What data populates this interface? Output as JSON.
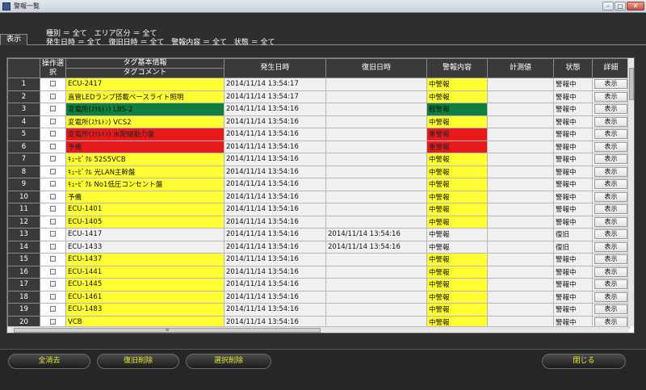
{
  "window": {
    "title": "警報一覧"
  },
  "tab": {
    "label": "表示"
  },
  "filters": {
    "line1": [
      "種別 ＝ 全て",
      "エリア区分 ＝ 全て"
    ],
    "line2": [
      "発生日時 ＝ 全て",
      "復旧日時 ＝ 全て",
      "警報内容 ＝ 全て",
      "状態 ＝ 全て"
    ]
  },
  "columns": {
    "select": "操作選択",
    "tag_info": "タグ基本情報",
    "tag_comment": "タグコメント",
    "occurred": "発生日時",
    "restored": "復旧日時",
    "alarm": "警報内容",
    "measured": "計測値",
    "state": "状態",
    "detail": "詳細"
  },
  "colors": {
    "yellow": "#ffff33",
    "green": "#0f7f3d",
    "red": "#e8191b",
    "gray": "#f0f0f0"
  },
  "rows": [
    {
      "num": "1",
      "comment": "ECU-2417",
      "occurred": "2014/11/14  13:54:17",
      "restored": "",
      "alarm": "中警報",
      "state": "警報中",
      "detail": "表示",
      "color": "y"
    },
    {
      "num": "2",
      "comment": "直管LEDランプ搭載ベースライト照明",
      "occurred": "2014/11/14  13:54:17",
      "restored": "",
      "alarm": "中警報",
      "state": "警報中",
      "detail": "表示",
      "color": "y"
    },
    {
      "num": "3",
      "comment": "変電所(ｽｹﾙﾄﾝ) LBS-2",
      "occurred": "2014/11/14  13:54:16",
      "restored": "",
      "alarm": "軽警報",
      "state": "警報中",
      "detail": "表示",
      "color": "g"
    },
    {
      "num": "4",
      "comment": "変電所(ｽｹﾙﾄﾝ) VCS2",
      "occurred": "2014/11/14  13:54:16",
      "restored": "",
      "alarm": "中警報",
      "state": "警報中",
      "detail": "表示",
      "color": "y"
    },
    {
      "num": "5",
      "comment": "変電所(ｽｹﾙﾄﾝ) 水配継動力盤",
      "occurred": "2014/11/14  13:54:16",
      "restored": "",
      "alarm": "重警報",
      "state": "警報中",
      "detail": "表示",
      "color": "r"
    },
    {
      "num": "6",
      "comment": "予備",
      "occurred": "2014/11/14  13:54:16",
      "restored": "",
      "alarm": "重警報",
      "state": "警報中",
      "detail": "表示",
      "color": "r"
    },
    {
      "num": "7",
      "comment": "ｷｭｰﾋﾞｸﾙ  52S5VCB",
      "occurred": "2014/11/14  13:54:16",
      "restored": "",
      "alarm": "中警報",
      "state": "警報中",
      "detail": "表示",
      "color": "y"
    },
    {
      "num": "8",
      "comment": "ｷｭｰﾋﾞｸﾙ  光LAN主幹盤",
      "occurred": "2014/11/14  13:54:16",
      "restored": "",
      "alarm": "中警報",
      "state": "警報中",
      "detail": "表示",
      "color": "y"
    },
    {
      "num": "9",
      "comment": "ｷｭｰﾋﾞｸﾙ  No1低圧コンセント盤",
      "occurred": "2014/11/14  13:54:16",
      "restored": "",
      "alarm": "中警報",
      "state": "警報中",
      "detail": "表示",
      "color": "y"
    },
    {
      "num": "10",
      "comment": "予備",
      "occurred": "2014/11/14  13:54:16",
      "restored": "",
      "alarm": "中警報",
      "state": "警報中",
      "detail": "表示",
      "color": "y"
    },
    {
      "num": "11",
      "comment": "ECU-1401",
      "occurred": "2014/11/14  13:54:16",
      "restored": "",
      "alarm": "中警報",
      "state": "警報中",
      "detail": "表示",
      "color": "y"
    },
    {
      "num": "12",
      "comment": "ECU-1405",
      "occurred": "2014/11/14  13:54:16",
      "restored": "",
      "alarm": "中警報",
      "state": "警報中",
      "detail": "表示",
      "color": "y"
    },
    {
      "num": "13",
      "comment": "ECU-1417",
      "occurred": "2014/11/14  13:54:16",
      "restored": "2014/11/14  13:54:16",
      "alarm": "中警報",
      "state": "復旧",
      "detail": "表示",
      "color": "w"
    },
    {
      "num": "14",
      "comment": "ECU-1433",
      "occurred": "2014/11/14  13:54:16",
      "restored": "2014/11/14  13:54:16",
      "alarm": "中警報",
      "state": "復旧",
      "detail": "表示",
      "color": "w"
    },
    {
      "num": "15",
      "comment": "ECU-1437",
      "occurred": "2014/11/14  13:54:16",
      "restored": "",
      "alarm": "中警報",
      "state": "警報中",
      "detail": "表示",
      "color": "y"
    },
    {
      "num": "16",
      "comment": "ECU-1441",
      "occurred": "2014/11/14  13:54:16",
      "restored": "",
      "alarm": "中警報",
      "state": "警報中",
      "detail": "表示",
      "color": "y"
    },
    {
      "num": "17",
      "comment": "ECU-1445",
      "occurred": "2014/11/14  13:54:16",
      "restored": "",
      "alarm": "中警報",
      "state": "警報中",
      "detail": "表示",
      "color": "y"
    },
    {
      "num": "18",
      "comment": "ECU-1461",
      "occurred": "2014/11/14  13:54:16",
      "restored": "",
      "alarm": "中警報",
      "state": "警報中",
      "detail": "表示",
      "color": "y"
    },
    {
      "num": "19",
      "comment": "ECU-1483",
      "occurred": "2014/11/14  13:54:16",
      "restored": "",
      "alarm": "中警報",
      "state": "警報中",
      "detail": "表示",
      "color": "y"
    },
    {
      "num": "20",
      "comment": "VCB",
      "occurred": "2014/11/14  13:54:16",
      "restored": "",
      "alarm": "中警報",
      "state": "警報中",
      "detail": "表示",
      "color": "y"
    }
  ],
  "buttons": {
    "clear_all": "全消去",
    "restore_delete": "復旧削除",
    "select_delete": "選択削除",
    "close": "閉じる"
  }
}
